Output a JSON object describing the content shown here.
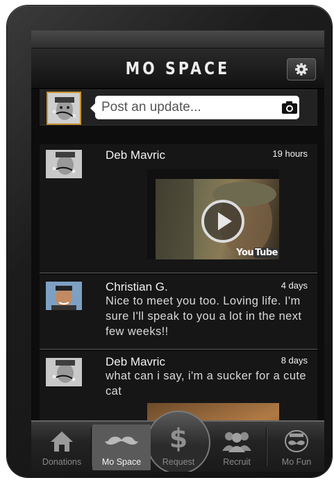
{
  "app": {
    "title": "MO SPACE"
  },
  "composer": {
    "placeholder": "Post an update..."
  },
  "posts": [
    {
      "author": "Deb Mavric",
      "time": "19 hours",
      "text": "",
      "media": {
        "type": "video",
        "badge": "YouTube"
      }
    },
    {
      "author": "Christian G.",
      "time": "4 days",
      "text": "Nice to meet you too. Loving life. I'm sure I'll speak to you a lot in the next few weeks!!"
    },
    {
      "author": "Deb Mavric",
      "time": "8 days",
      "text": "what can i say, i'm a sucker for a cute cat",
      "media": {
        "type": "image"
      }
    }
  ],
  "tabs": [
    {
      "label": "Donations",
      "icon": "house-icon",
      "active": false
    },
    {
      "label": "Mo Space",
      "icon": "mustache-icon",
      "active": true
    },
    {
      "label": "Request",
      "icon": "dollar-icon",
      "active": false
    },
    {
      "label": "Recruit",
      "icon": "people-icon",
      "active": false
    },
    {
      "label": "Mo Fun",
      "icon": "mo-fun-badge-icon",
      "active": false
    }
  ],
  "colors": {
    "accent_border": "#c8922e",
    "active_tab": "#5a5a5a",
    "background": "#0d0d0d"
  }
}
